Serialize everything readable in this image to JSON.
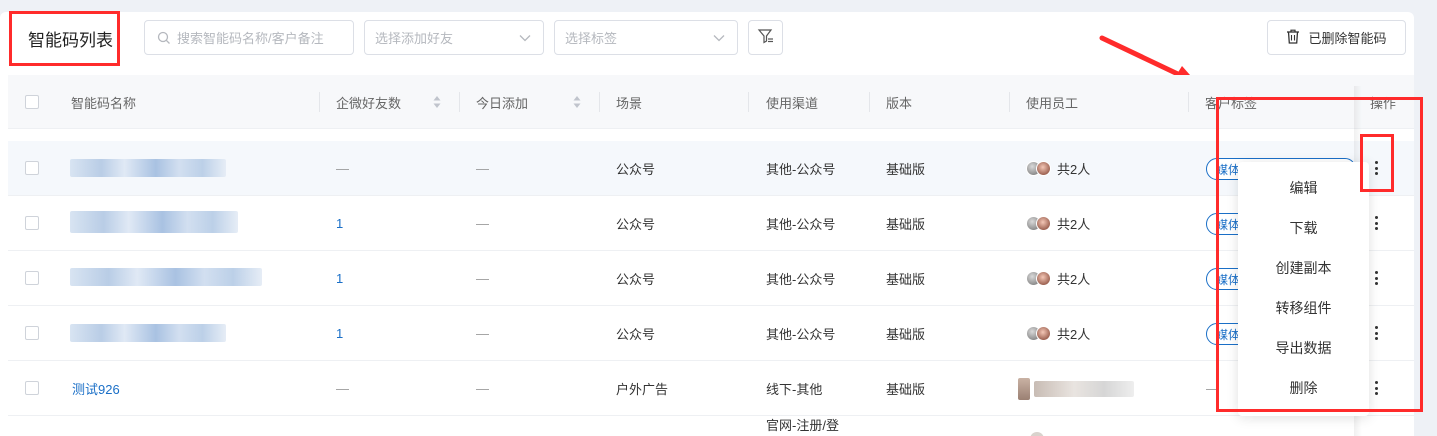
{
  "header": {
    "title": "智能码列表",
    "search_placeholder": "搜索智能码名称/客户备注",
    "friend_select_placeholder": "选择添加好友",
    "tag_select_placeholder": "选择标签",
    "deleted_button_label": "已删除智能码"
  },
  "table": {
    "columns": [
      "智能码名称",
      "企微好友数",
      "今日添加",
      "场景",
      "使用渠道",
      "版本",
      "使用员工",
      "客户标签",
      "操作"
    ],
    "rows": [
      {
        "name": "",
        "friends": "—",
        "today": "—",
        "scene": "公众号",
        "channel": "其他-公众号",
        "version": "基础版",
        "employees": "共2人",
        "tag": "媒体"
      },
      {
        "name": "",
        "friends": "1",
        "today": "—",
        "scene": "公众号",
        "channel": "其他-公众号",
        "version": "基础版",
        "employees": "共2人",
        "tag": "媒体"
      },
      {
        "name": "",
        "friends": "1",
        "today": "—",
        "scene": "公众号",
        "channel": "其他-公众号",
        "version": "基础版",
        "employees": "共2人",
        "tag": "媒体"
      },
      {
        "name": "",
        "friends": "1",
        "today": "—",
        "scene": "公众号",
        "channel": "其他-公众号",
        "version": "基础版",
        "employees": "共2人",
        "tag": "媒体"
      },
      {
        "name": "测试926",
        "friends": "—",
        "today": "—",
        "scene": "户外广告",
        "channel": "线下-其他",
        "version": "基础版",
        "employees": "",
        "tag": "—"
      },
      {
        "name": "",
        "friends": "",
        "today": "",
        "scene": "",
        "channel": "官网-注册/登",
        "version": "",
        "employees": "",
        "tag": ""
      }
    ]
  },
  "dropdown_menu": {
    "items": [
      "编辑",
      "下载",
      "创建副本",
      "转移组件",
      "导出数据",
      "删除"
    ]
  },
  "colors": {
    "accent": "#1a6fc7",
    "annotation_red": "#ff2b2b"
  }
}
